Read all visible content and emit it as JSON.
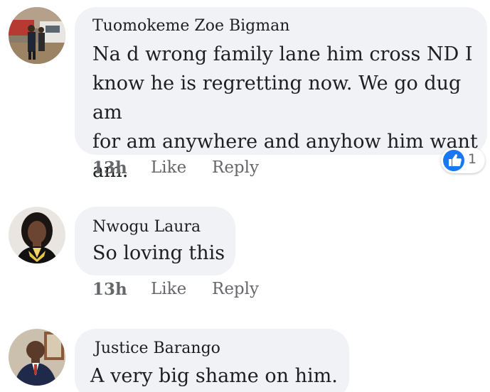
{
  "comments": [
    {
      "author": "Tuomokeme Zoe Bigman",
      "text_lines": [
        "Na d wrong family lane him cross ND I",
        "know he is regretting now. We go dug am",
        "for am anywhere and anyhow him want",
        "am."
      ],
      "time": "13h",
      "like_label": "Like",
      "reply_label": "Reply",
      "reaction": {
        "icon": "thumbs-up-icon",
        "count": "1",
        "color": "#1877f2"
      }
    },
    {
      "author": "Nwogu Laura",
      "text_lines": [
        "So loving this"
      ],
      "time": "13h",
      "like_label": "Like",
      "reply_label": "Reply"
    },
    {
      "author": "Justice Barango",
      "text_lines": [
        "A very big shame on him."
      ]
    }
  ],
  "colors": {
    "bubble": "#f0f2f5",
    "meta_text": "#65676b",
    "like_blue": "#1877f2"
  }
}
